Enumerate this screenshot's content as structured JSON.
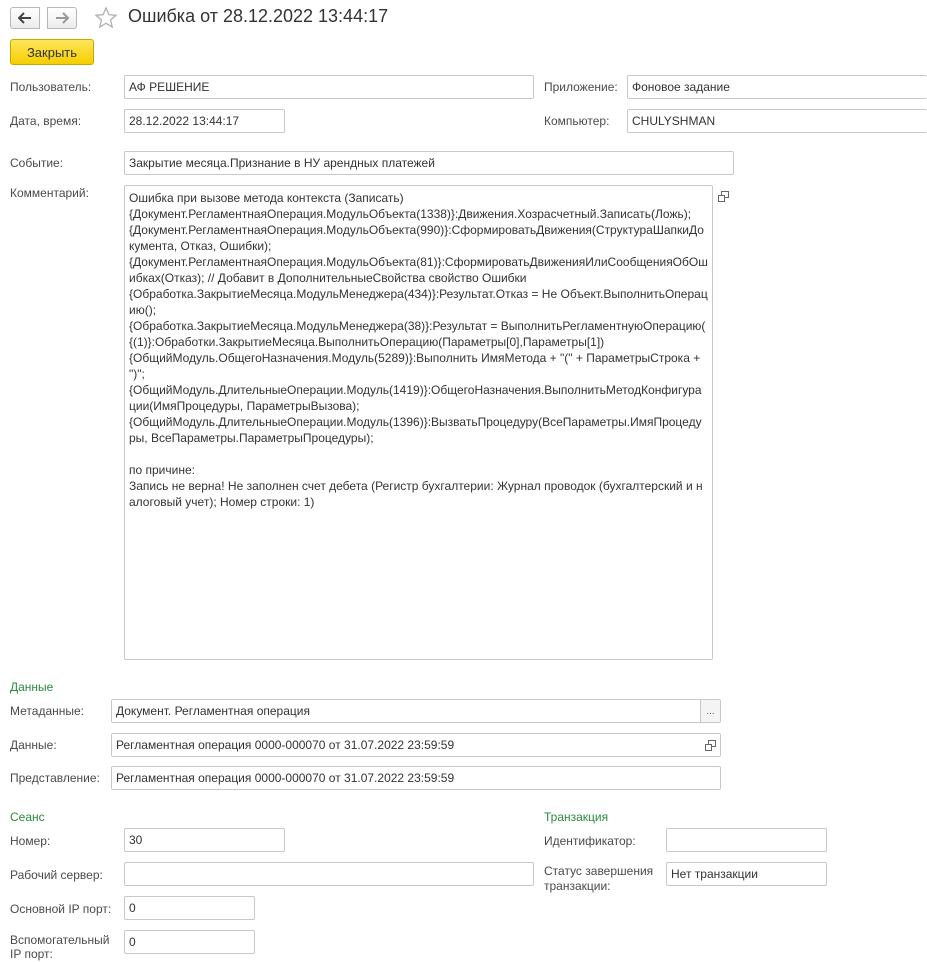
{
  "window": {
    "title": "Ошибка от 28.12.2022 13:44:17"
  },
  "icons": {
    "back": "arrow-left-icon",
    "forward": "arrow-right-icon",
    "favorite": "star-icon",
    "open": "open-window-icon",
    "select": "ellipsis-icon"
  },
  "toolbar": {
    "close_label": "Закрыть"
  },
  "main": {
    "user": {
      "label": "Пользователь:",
      "value": "АФ РЕШЕНИЕ"
    },
    "app": {
      "label": "Приложение:",
      "value": "Фоновое задание"
    },
    "date": {
      "label": "Дата, время:",
      "value": "28.12.2022 13:44:17"
    },
    "computer": {
      "label": "Компьютер:",
      "value": "CHULYSHMAN"
    },
    "event": {
      "label": "Событие:",
      "value": "Закрытие месяца.Признание в НУ арендных платежей"
    },
    "comment": {
      "label": "Комментарий:",
      "value": "Ошибка при вызове метода контекста (Записать)\n{Документ.РегламентнаяОперация.МодульОбъекта(1338)}:Движения.Хозрасчетный.Записать(Ложь);\n{Документ.РегламентнаяОперация.МодульОбъекта(990)}:СформироватьДвижения(СтруктураШапкиДокумента, Отказ, Ошибки);\n{Документ.РегламентнаяОперация.МодульОбъекта(81)}:СформироватьДвиженияИлиСообщенияОбОшибках(Отказ); // Добавит в ДополнительныеСвойства свойство Ошибки\n{Обработка.ЗакрытиеМесяца.МодульМенеджера(434)}:Результат.Отказ = Не Объект.ВыполнитьОперацию();\n{Обработка.ЗакрытиеМесяца.МодульМенеджера(38)}:Результат = ВыполнитьРегламентнуюОперацию(\n{(1)}:Обработки.ЗакрытиеМесяца.ВыполнитьОперацию(Параметры[0],Параметры[1])\n{ОбщийМодуль.ОбщегоНазначения.Модуль(5289)}:Выполнить ИмяМетода + \"(\" + ПараметрыСтрока + \")\";\n{ОбщийМодуль.ДлительныеОперации.Модуль(1419)}:ОбщегоНазначения.ВыполнитьМетодКонфигурации(ИмяПроцедуры, ПараметрыВызова);\n{ОбщийМодуль.ДлительныеОперации.Модуль(1396)}:ВызватьПроцедуру(ВсеПараметры.ИмяПроцедуры, ВсеПараметры.ПараметрыПроцедуры);\n\nпо причине:\nЗапись не верна! Не заполнен счет дебета (Регистр бухгалтерии: Журнал проводок (бухгалтерский и налоговый учет); Номер строки: 1)"
    }
  },
  "data_section": {
    "title": "Данные",
    "metadata": {
      "label": "Метаданные:",
      "value": "Документ. Регламентная операция"
    },
    "data": {
      "label": "Данные:",
      "value": "Регламентная операция 0000-000070 от 31.07.2022 23:59:59"
    },
    "presentation": {
      "label": "Представление:",
      "value": "Регламентная операция 0000-000070 от 31.07.2022 23:59:59"
    }
  },
  "session": {
    "title": "Сеанс",
    "number": {
      "label": "Номер:",
      "value": "30"
    },
    "work_server": {
      "label": "Рабочий сервер:",
      "value": ""
    },
    "main_ip_port": {
      "label": "Основной IP порт:",
      "value": "0"
    },
    "aux_ip_port": {
      "label_line1": "Вспомогательный",
      "label_line2": "IP порт:",
      "value": "0"
    }
  },
  "transaction": {
    "title": "Транзакция",
    "id": {
      "label": "Идентификатор:",
      "value": ""
    },
    "status": {
      "label_line1": "Статус завершения",
      "label_line2": "транзакции:",
      "value": "Нет транзакции"
    }
  }
}
